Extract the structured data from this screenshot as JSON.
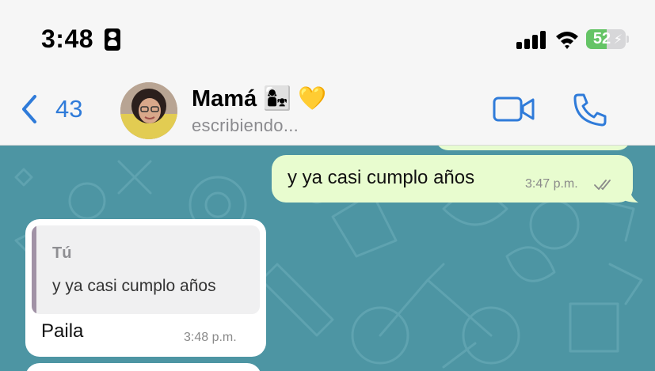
{
  "status_bar": {
    "time": "3:48",
    "battery_level": "52",
    "icons": [
      "contact-card-icon",
      "cellular-signal-icon",
      "wifi-icon",
      "battery-charging-icon"
    ]
  },
  "header": {
    "back_count": "43",
    "contact_name": "Mamá 👩‍👧 💛",
    "status": "escribiendo...",
    "icons": [
      "back-chevron-icon",
      "video-call-icon",
      "phone-icon"
    ]
  },
  "messages": [
    {
      "direction": "outgoing",
      "text": "y ya casi cumplo años",
      "time": "3:47 p.m.",
      "read_status": "double-check-icon"
    },
    {
      "direction": "incoming",
      "quote": {
        "author": "Tú",
        "text": "y ya casi cumplo años"
      },
      "text": "Paila",
      "time": "3:48 p.m."
    }
  ],
  "colors": {
    "accent": "#2f7bd9",
    "chat_background": "#4d95a3",
    "outgoing_bubble": "#e8fccf",
    "incoming_bubble": "#ffffff",
    "battery_fill": "#65c466",
    "quote_bar": "#a192a6"
  }
}
